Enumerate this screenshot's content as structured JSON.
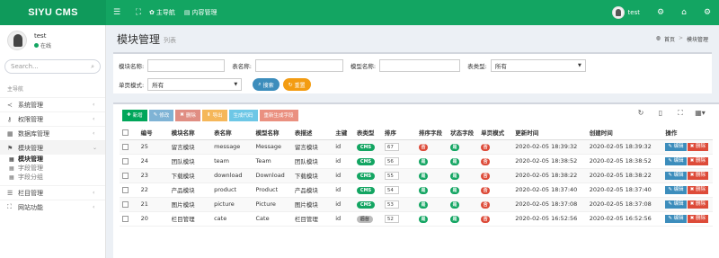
{
  "app": {
    "logo": "SIYU CMS",
    "top_menus": [
      {
        "icon": "home-icon",
        "label": "主导航"
      },
      {
        "icon": "content-icon",
        "label": "内容管理"
      }
    ],
    "user_name": "test"
  },
  "sidebar": {
    "user_name": "test",
    "status": "在线",
    "search_placeholder": "Search...",
    "nav_header": "主导航",
    "items": [
      {
        "label": "系统管理",
        "icon": "share-icon"
      },
      {
        "label": "权限管理",
        "icon": "key-icon"
      },
      {
        "label": "数据库管理",
        "icon": "database-icon"
      },
      {
        "label": "模块管理",
        "icon": "module-icon"
      },
      {
        "label": "栏目管理",
        "icon": "list-icon"
      },
      {
        "label": "网站功能",
        "icon": "sitemap-icon"
      }
    ],
    "sub_items": [
      {
        "label": "模块管理"
      },
      {
        "label": "字段管理"
      },
      {
        "label": "字段分组"
      }
    ]
  },
  "page": {
    "title": "模块管理",
    "subtitle": "列表",
    "breadcrumb": [
      "首页",
      "模块管理"
    ]
  },
  "filters": {
    "module_name_label": "模块名称:",
    "table_name_label": "表名称:",
    "model_name_label": "模型名称:",
    "table_type_label": "表类型:",
    "table_type_value": "所有",
    "single_page_label": "单页模式:",
    "single_page_value": "所有",
    "search_label": "搜索",
    "reset_label": "重置"
  },
  "toolbar": {
    "buttons": [
      {
        "label": "新增",
        "icon": "plus-icon",
        "color": "#00a65a"
      },
      {
        "label": "修改",
        "icon": "edit-icon",
        "color": "#7fb3d5"
      },
      {
        "label": "删除",
        "icon": "trash-icon",
        "color": "#e08e83"
      },
      {
        "label": "导出",
        "icon": "download-icon",
        "color": "#f5b75a"
      },
      {
        "label": "生成代码",
        "icon": "code-icon",
        "color": "#6dc7e6"
      },
      {
        "label": "重新生成字段",
        "icon": "refresh-icon",
        "color": "#ea9080"
      }
    ]
  },
  "table": {
    "columns": [
      "",
      "编号",
      "模块名称",
      "表名称",
      "模型名称",
      "表描述",
      "主键",
      "表类型",
      "排序",
      "排序字段",
      "状态字段",
      "单页模式",
      "更新时间",
      "创建时间",
      "操作"
    ],
    "rows": [
      {
        "id": "25",
        "name": "留言模块",
        "table": "message",
        "model": "Message",
        "desc": "留言模块",
        "pk": "id",
        "type": "CMS",
        "type_style": "green",
        "sort": "67",
        "sort_field": "否",
        "sort_field_style": "red",
        "status_field": "是",
        "status_field_style": "green",
        "single": "否",
        "single_style": "red",
        "updated": "2020-02-05 18:39:32",
        "created": "2020-02-05 18:39:32"
      },
      {
        "id": "24",
        "name": "团队模块",
        "table": "team",
        "model": "Team",
        "desc": "团队模块",
        "pk": "id",
        "type": "CMS",
        "type_style": "green",
        "sort": "56",
        "sort_field": "是",
        "sort_field_style": "green",
        "status_field": "是",
        "status_field_style": "green",
        "single": "否",
        "single_style": "red",
        "updated": "2020-02-05 18:38:52",
        "created": "2020-02-05 18:38:52"
      },
      {
        "id": "23",
        "name": "下载模块",
        "table": "download",
        "model": "Download",
        "desc": "下载模块",
        "pk": "id",
        "type": "CMS",
        "type_style": "green",
        "sort": "55",
        "sort_field": "是",
        "sort_field_style": "green",
        "status_field": "是",
        "status_field_style": "green",
        "single": "否",
        "single_style": "red",
        "updated": "2020-02-05 18:38:22",
        "created": "2020-02-05 18:38:22"
      },
      {
        "id": "22",
        "name": "产品模块",
        "table": "product",
        "model": "Product",
        "desc": "产品模块",
        "pk": "id",
        "type": "CMS",
        "type_style": "green",
        "sort": "54",
        "sort_field": "是",
        "sort_field_style": "green",
        "status_field": "是",
        "status_field_style": "green",
        "single": "否",
        "single_style": "red",
        "updated": "2020-02-05 18:37:40",
        "created": "2020-02-05 18:37:40"
      },
      {
        "id": "21",
        "name": "图片模块",
        "table": "picture",
        "model": "Picture",
        "desc": "图片模块",
        "pk": "id",
        "type": "CMS",
        "type_style": "green",
        "sort": "53",
        "sort_field": "是",
        "sort_field_style": "green",
        "status_field": "是",
        "status_field_style": "green",
        "single": "否",
        "single_style": "red",
        "updated": "2020-02-05 18:37:08",
        "created": "2020-02-05 18:37:08"
      },
      {
        "id": "20",
        "name": "栏目管理",
        "table": "cate",
        "model": "Cate",
        "desc": "栏目管理",
        "pk": "id",
        "type": "后台",
        "type_style": "gray",
        "sort": "52",
        "sort_field": "是",
        "sort_field_style": "green",
        "status_field": "是",
        "status_field_style": "green",
        "single": "否",
        "single_style": "red",
        "updated": "2020-02-05 16:52:56",
        "created": "2020-02-05 16:52:56"
      }
    ],
    "edit_label": "编辑",
    "delete_label": "删除"
  },
  "colors": {
    "brand": "#13a562",
    "primary": "#3c8dbc",
    "danger": "#dd4b39",
    "warning": "#f39c12"
  }
}
